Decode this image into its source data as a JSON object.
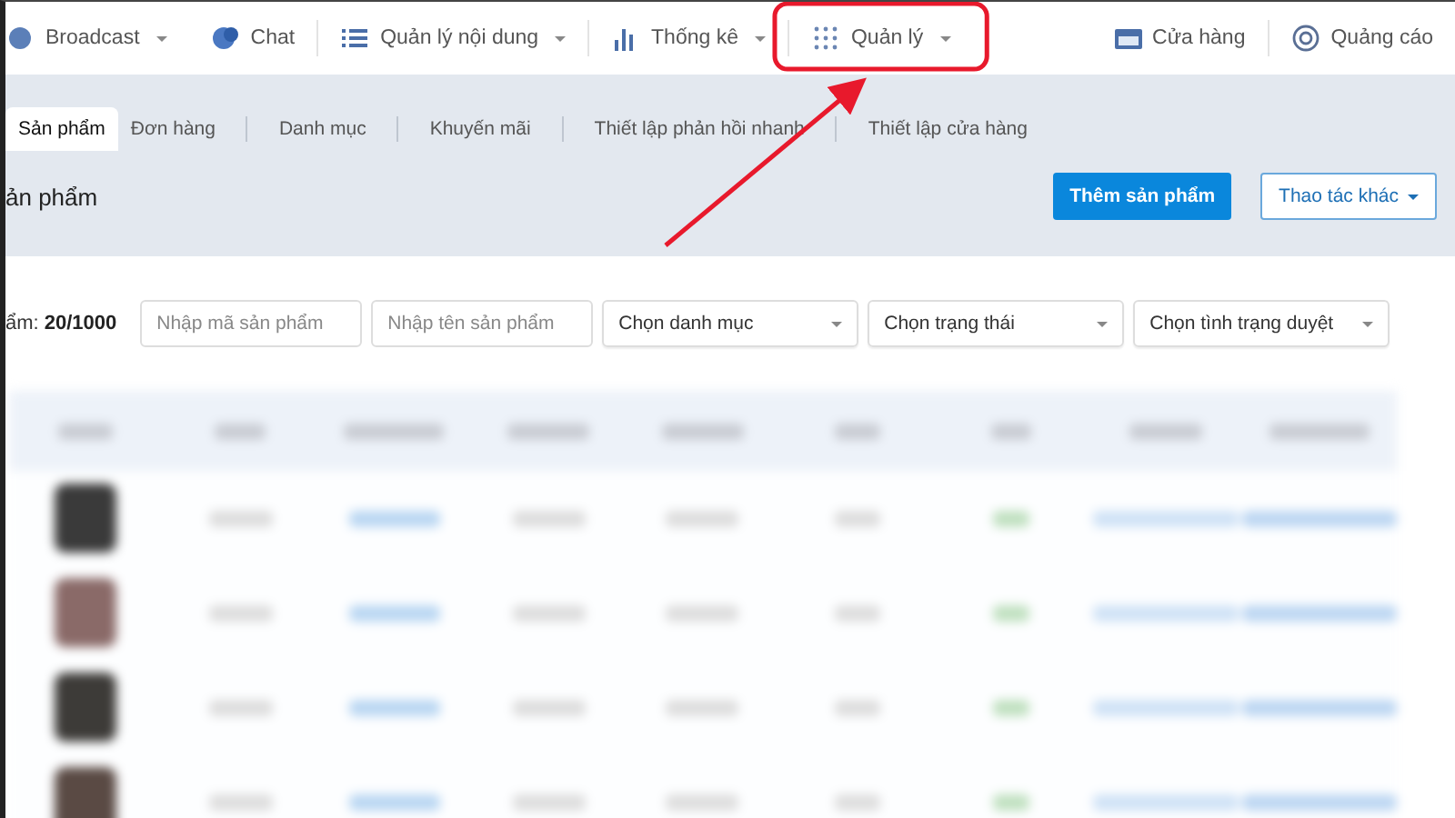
{
  "nav": [
    {
      "label": "Broadcast",
      "has_menu": true,
      "highlighted": false
    },
    {
      "label": "Chat",
      "has_menu": false,
      "highlighted": false
    },
    {
      "label": "Quản lý nội dung",
      "has_menu": true,
      "highlighted": false
    },
    {
      "label": "Thống kê",
      "has_menu": true,
      "highlighted": false
    },
    {
      "label": "Quản lý",
      "has_menu": true,
      "highlighted": true
    },
    {
      "label": "Cửa hàng",
      "has_menu": false,
      "highlighted": false
    },
    {
      "label": "Quảng cáo",
      "has_menu": false,
      "highlighted": false
    }
  ],
  "tabs": [
    {
      "label": "Sản phẩm",
      "selected": true
    },
    {
      "label": "Đơn hàng",
      "selected": false
    },
    {
      "label": "Danh mục",
      "selected": false
    },
    {
      "label": "Khuyến mãi",
      "selected": false
    },
    {
      "label": "Thiết lập phản hồi nhanh",
      "selected": false
    },
    {
      "label": "Thiết lập cửa hàng",
      "selected": false
    }
  ],
  "page_title": "ản phẩm",
  "actions": [
    {
      "label": "Thêm sản phẩm",
      "kind": "primary",
      "has_menu": false
    },
    {
      "label": "Thao tác khác",
      "kind": "secondary",
      "has_menu": true
    }
  ],
  "filters": {
    "count_label": "ẩm:",
    "count": "20/1000",
    "fields": [
      {
        "kind": "input",
        "placeholder": "Nhập mã sản phẩm"
      },
      {
        "kind": "input",
        "placeholder": "Nhập tên sản phẩm"
      },
      {
        "kind": "select",
        "value": "Chọn danh mục"
      },
      {
        "kind": "select",
        "value": "Chọn trạng thái"
      },
      {
        "kind": "select",
        "value": "Chọn tình trạng duyệt"
      }
    ]
  }
}
